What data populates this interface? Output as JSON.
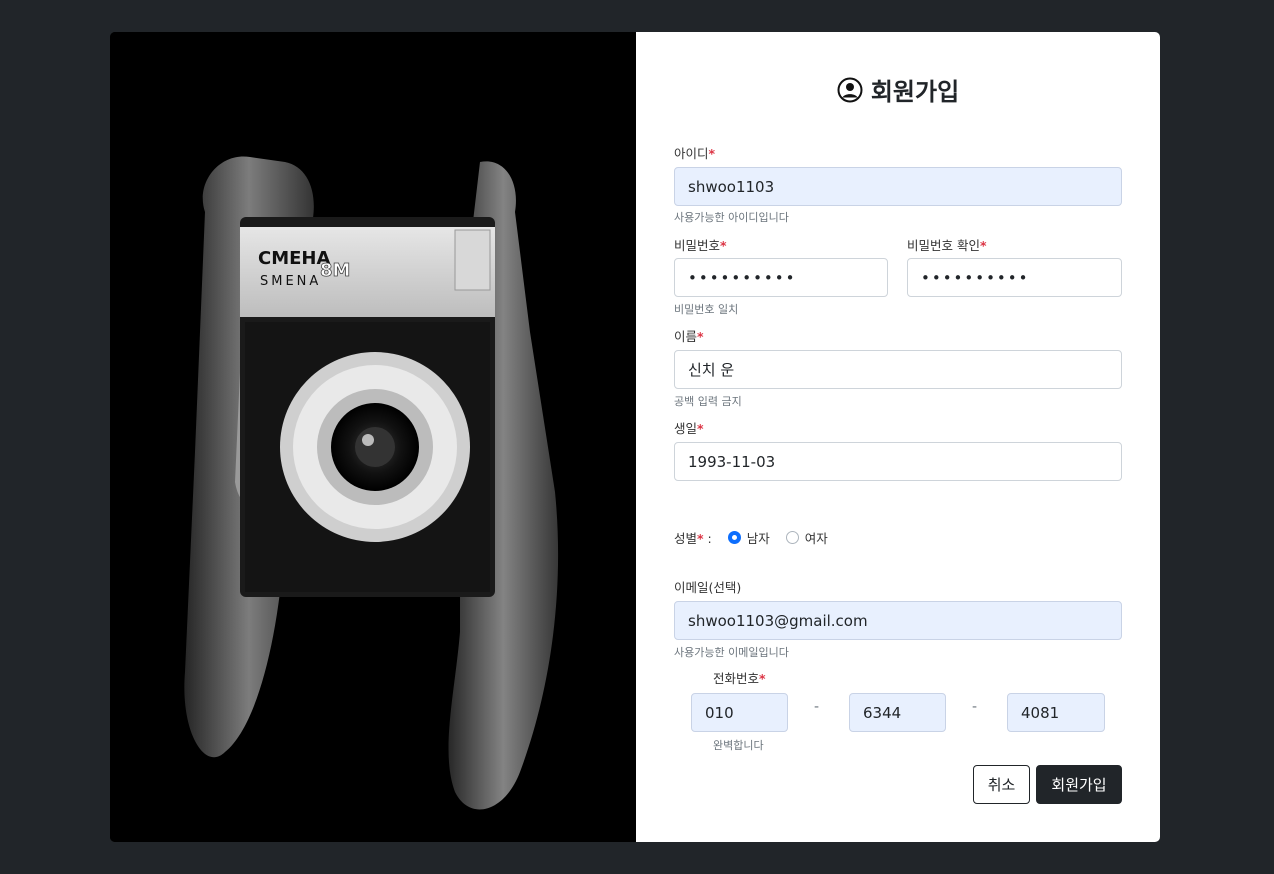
{
  "form": {
    "title": "회원가입",
    "required_mark": "*",
    "id": {
      "label": "아이디",
      "value": "shwoo1103",
      "help": "사용가능한 아이디입니다"
    },
    "password": {
      "label": "비밀번호",
      "value": "••••••••••"
    },
    "password_confirm": {
      "label": "비밀번호 확인",
      "value": "••••••••••",
      "help": "비밀번호 일치"
    },
    "name": {
      "label": "이름",
      "value": "신치 운",
      "help": "공백 입력 금지"
    },
    "birth": {
      "label": "생일",
      "value": "1993-11-03"
    },
    "gender": {
      "label": "성별",
      "colon": " :",
      "options": [
        "남자",
        "여자"
      ],
      "selected": "남자"
    },
    "email": {
      "label": "이메일(선택)",
      "value": "shwoo1103@gmail.com",
      "help": "사용가능한 이메일입니다"
    },
    "phone": {
      "label": "전화번호",
      "part1": "010",
      "part2": "6344",
      "part3": "4081",
      "dash": "-",
      "help": "완벽합니다"
    },
    "cancel_label": "취소",
    "submit_label": "회원가입"
  },
  "photo": {
    "camera_brand_cyrillic": "СМЕНА",
    "camera_brand_latin": "SMENA",
    "camera_model": "8M"
  },
  "colors": {
    "page_bg": "#212529",
    "accent": "#0d6efd",
    "required": "#dc3545",
    "autofill_bg": "#e8f0fe"
  }
}
